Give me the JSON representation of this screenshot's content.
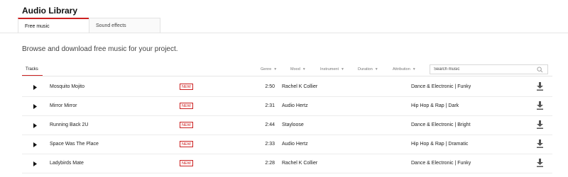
{
  "app": {
    "title": "Audio Library"
  },
  "tabs": [
    {
      "label": "Free music",
      "active": true
    },
    {
      "label": "Sound effects",
      "active": false
    }
  ],
  "subtitle": "Browse and download free music for your project.",
  "toolbar": {
    "tracks_label": "Tracks",
    "filters": [
      {
        "label": "Genre"
      },
      {
        "label": "Mood"
      },
      {
        "label": "Instrument"
      },
      {
        "label": "Duration"
      },
      {
        "label": "Attribution"
      }
    ],
    "caret_icon": "caret-down-icon",
    "search": {
      "placeholder": "Search music",
      "value": "",
      "icon": "search-icon"
    }
  },
  "badge_label": "NEW",
  "colors": {
    "accent": "#cc2020",
    "text": "#222222",
    "muted": "#777777"
  },
  "tracks": [
    {
      "title": "Mosquito Mojito",
      "duration": "2:50",
      "artist": "Rachel K Collier",
      "genre_mood": "Dance & Electronic | Funky"
    },
    {
      "title": "Mirror Mirror",
      "duration": "2:31",
      "artist": "Audio Hertz",
      "genre_mood": "Hip Hop & Rap | Dark"
    },
    {
      "title": "Running Back 2U",
      "duration": "2:44",
      "artist": "Stayloose",
      "genre_mood": "Dance & Electronic | Bright"
    },
    {
      "title": "Space Was The Place",
      "duration": "2:33",
      "artist": "Audio Hertz",
      "genre_mood": "Hip Hop & Rap | Dramatic"
    },
    {
      "title": "Ladybirds Mate",
      "duration": "2:28",
      "artist": "Rachel K Collier",
      "genre_mood": "Dance & Electronic | Funky"
    }
  ]
}
